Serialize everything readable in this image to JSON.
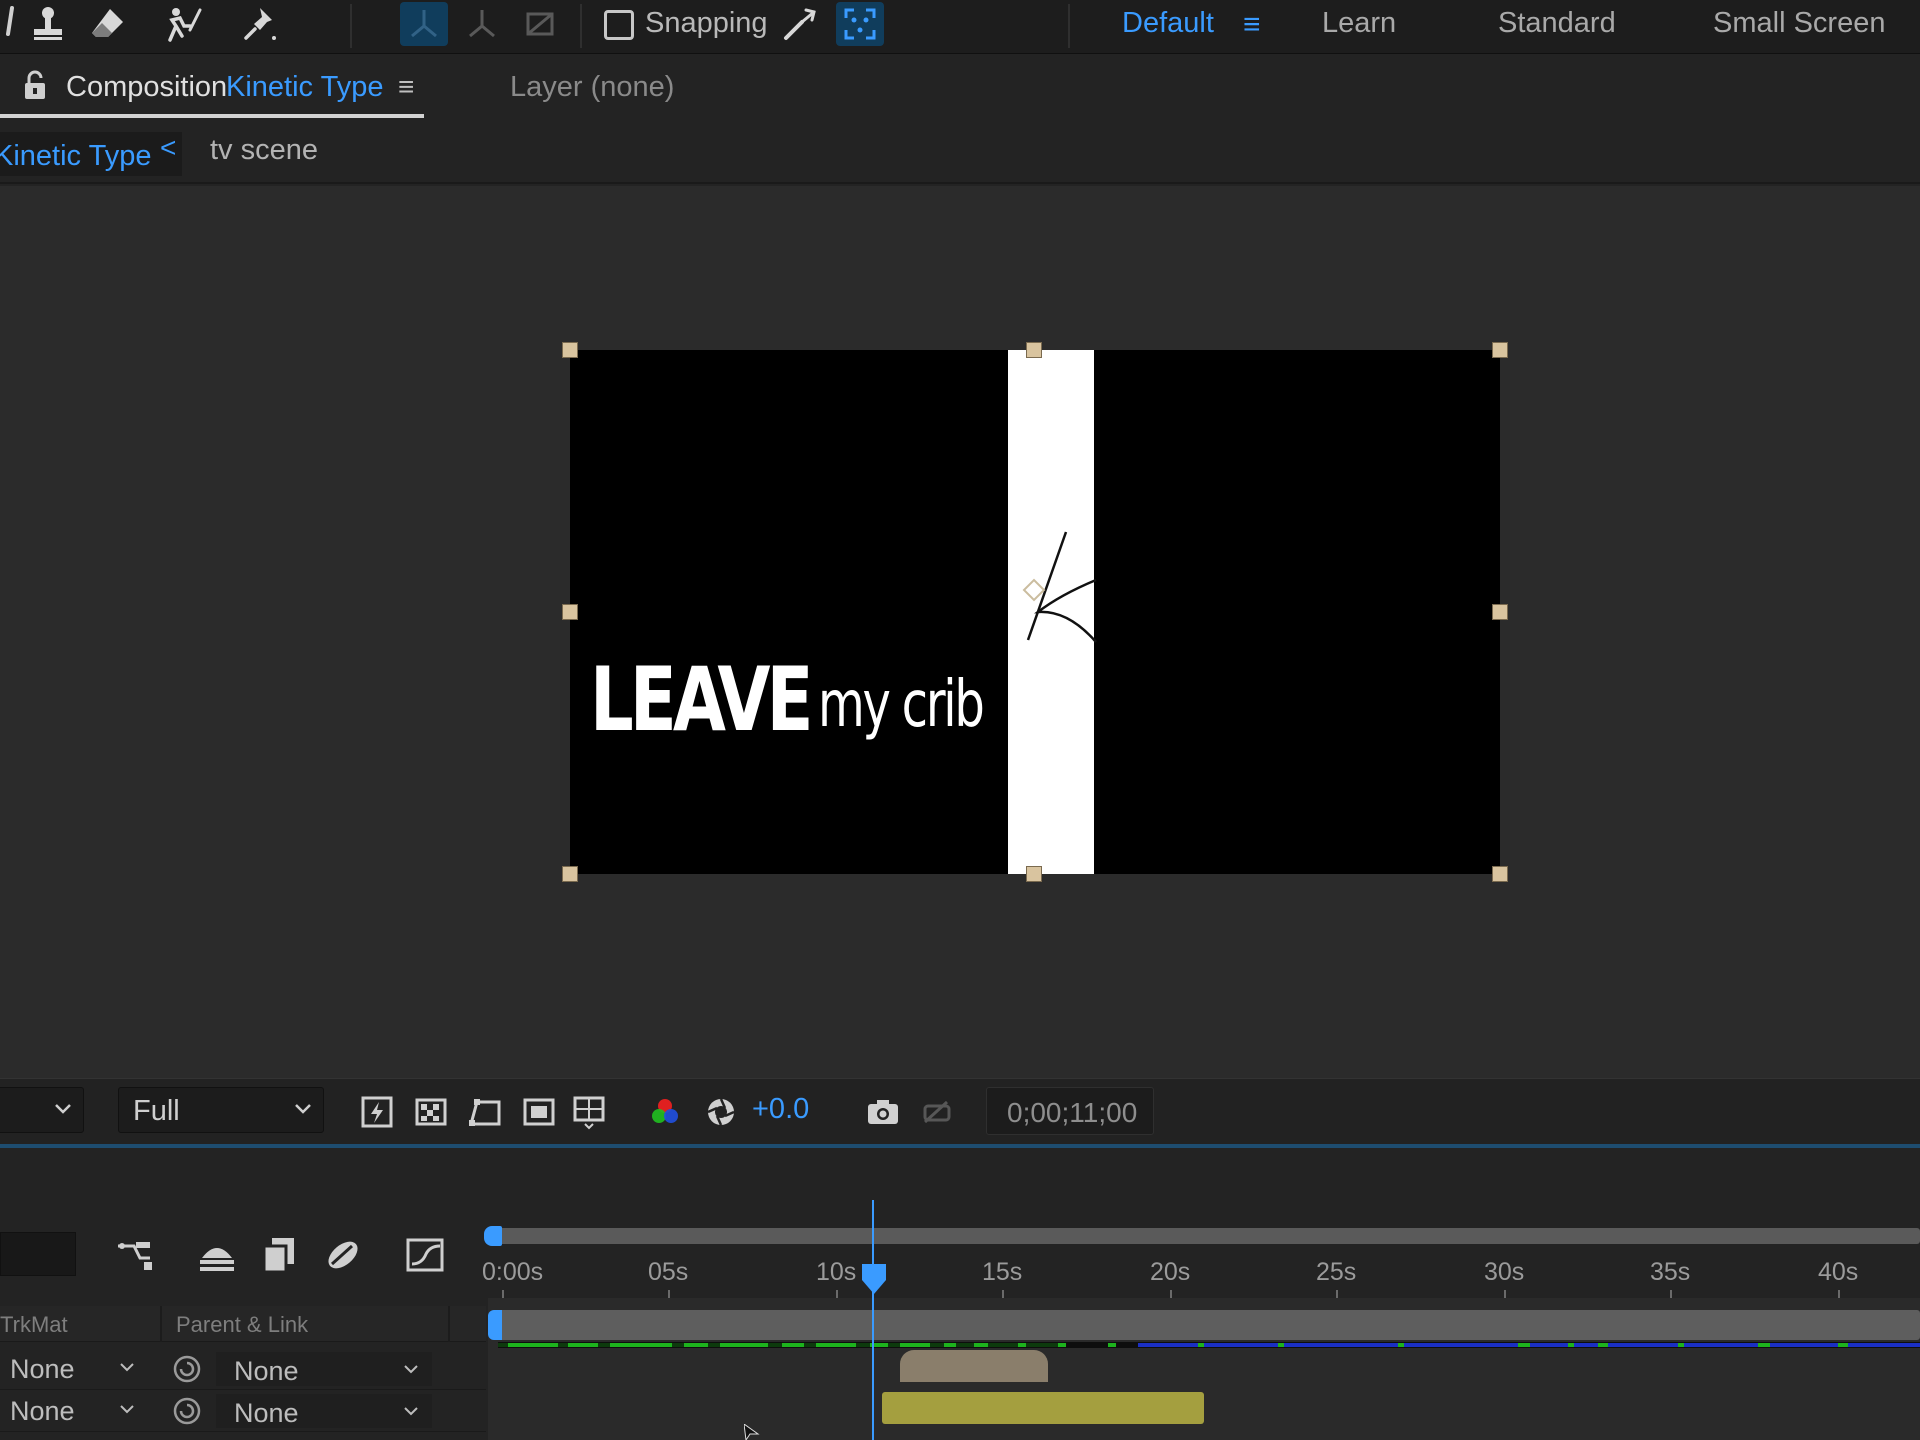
{
  "toolbar": {
    "tools": [
      "pen-tool-icon",
      "clone-stamp-icon",
      "eraser-icon",
      "roto-brush-icon",
      "puppet-pin-icon",
      "local-axis-icon",
      "world-axis-icon",
      "view-axis-icon"
    ],
    "snapping_label": "Snapping",
    "workspaces": {
      "default": "Default",
      "menu_glyph": "≡",
      "learn": "Learn",
      "standard": "Standard",
      "small_screen": "Small Screen"
    }
  },
  "composition_panel": {
    "tab_prefix": "Composition",
    "comp_name": "Kinetic Type",
    "menu_glyph": "≡",
    "layer_panel_label": "Layer  (none)"
  },
  "breadcrumbs": {
    "active": "Kinetic Type",
    "arrow": "<",
    "parent": "tv scene"
  },
  "canvas": {
    "text_bold": "LEAVE",
    "text_light": "my crib"
  },
  "viewer_bar": {
    "resolution": "Full",
    "exposure": "+0.0",
    "timecode": "0;00;11;00"
  },
  "timeline": {
    "ruler_labels": [
      "0:00s",
      "05s",
      "10s",
      "15s",
      "20s",
      "25s",
      "30s",
      "35s",
      "40s"
    ],
    "column_headers": {
      "trkmat": "TrkMat",
      "parent_link": "Parent & Link"
    },
    "layers": [
      {
        "trkmat": "None",
        "parent": "None"
      },
      {
        "trkmat": "None",
        "parent": "None"
      }
    ]
  },
  "colors": {
    "accent": "#3a9bff",
    "panel": "#232323",
    "viewer": "#2b2b2b",
    "layer_bar_1": "#8a7e6b",
    "layer_bar_2": "#a49f3f",
    "cache_green": "#1db31d",
    "cache_blue": "#1a2fc4"
  }
}
